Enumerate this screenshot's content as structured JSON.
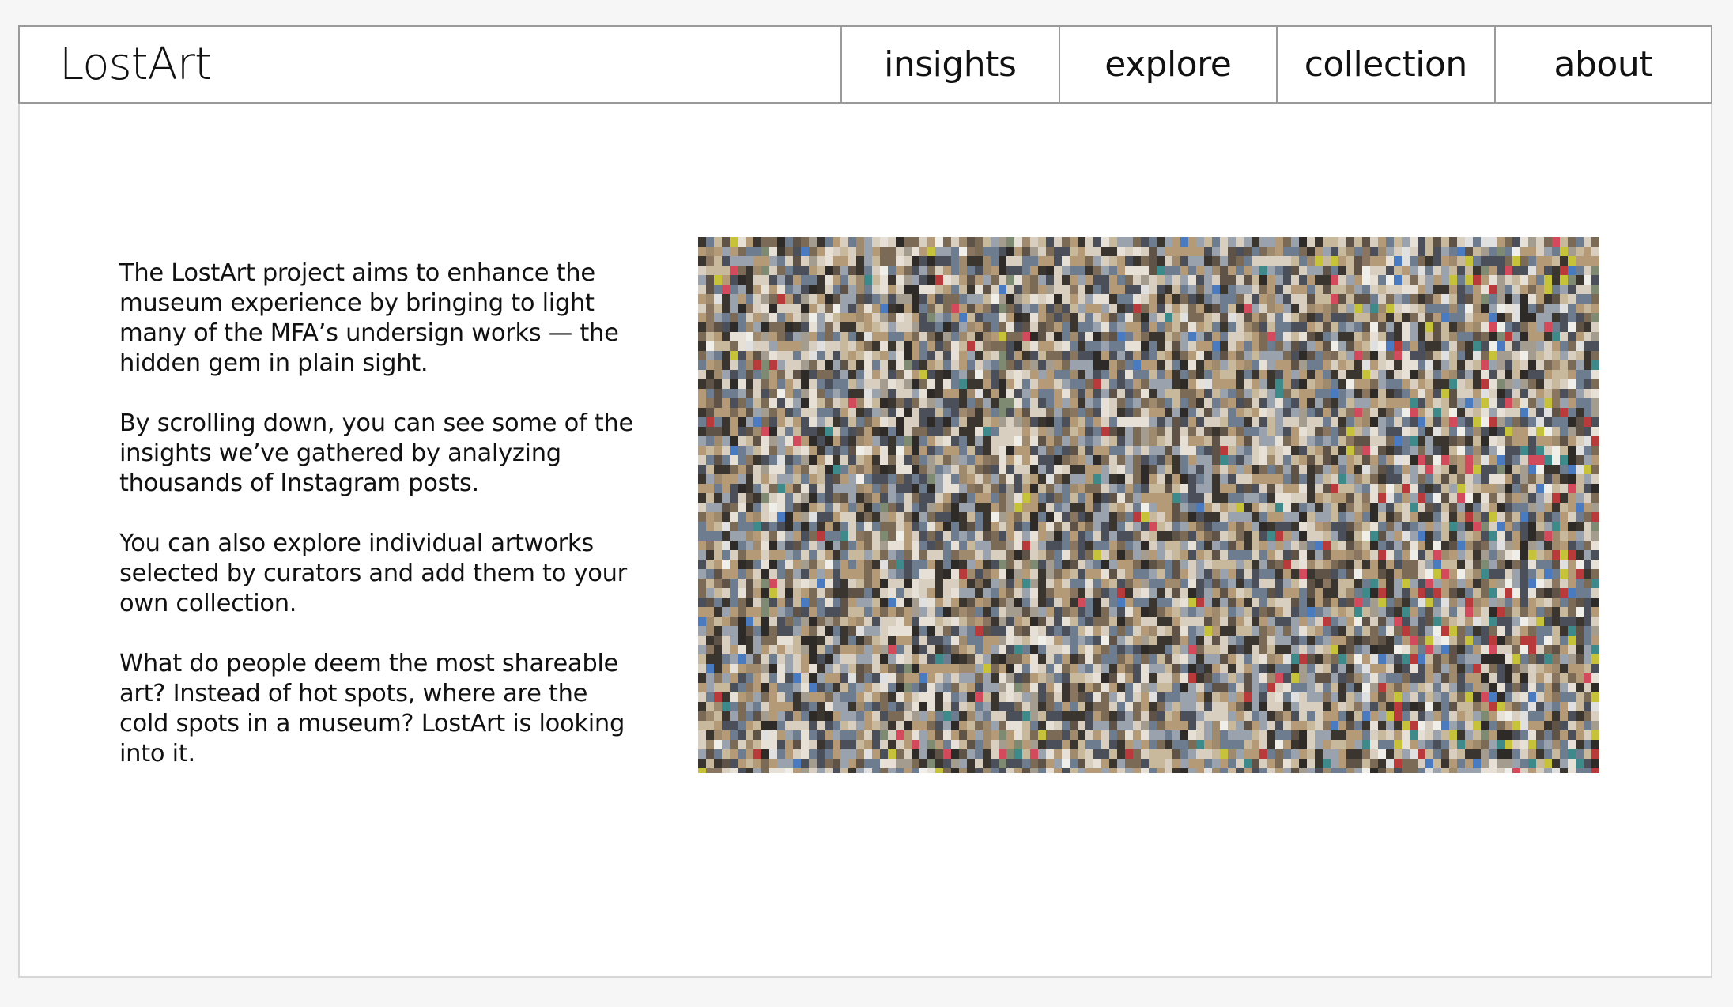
{
  "header": {
    "brand": "LostArt",
    "nav": [
      {
        "label": "insights"
      },
      {
        "label": "explore"
      },
      {
        "label": "collection"
      },
      {
        "label": "about"
      }
    ]
  },
  "intro": {
    "paragraphs": [
      "The LostArt project aims to enhance the museum experience by bringing to light many of the MFA’s undersign works — the hidden gem in plain sight.",
      "By scrolling down, you can see some of the insights we’ve gathered by analyzing thousands of Instagram posts.",
      "You can also explore individual artworks selected by curators and add them to your own collection.",
      "What do people deem the most shareable art? Instead of hot spots, where are the cold spots in a museum? LostArt is looking into it."
    ]
  },
  "mosaic": {
    "palette": [
      "#8a7560",
      "#a08a6e",
      "#5e5346",
      "#c8b89c",
      "#3b352f",
      "#9aa3ad",
      "#6d7c8e",
      "#b59a78",
      "#d9cfc0",
      "#4a4f5a",
      "#7b6a55",
      "#e6e0d6",
      "#2e2a27",
      "#a59c90",
      "#7f8a72"
    ],
    "accent_palette": [
      "#c6c23a",
      "#d24a5c",
      "#4a7bc0",
      "#e0e0e0",
      "#b83a3a",
      "#f0eee8",
      "#3e8a8a"
    ]
  }
}
